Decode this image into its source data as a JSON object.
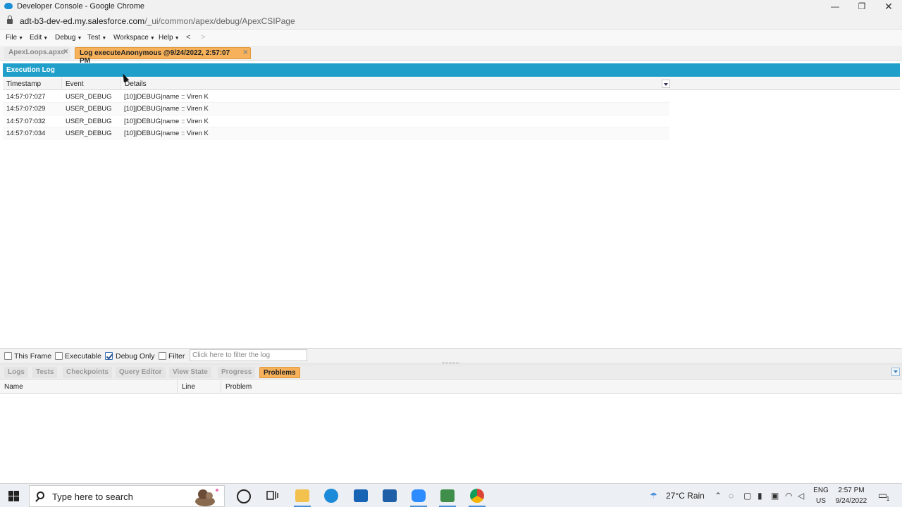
{
  "window": {
    "title": "Developer Console - Google Chrome",
    "minimize": "—",
    "maximize": "❐",
    "close": "✕"
  },
  "address": {
    "host": "adt-b3-dev-ed.my.salesforce.com",
    "path": "/_ui/common/apex/debug/ApexCSIPage"
  },
  "menu": {
    "items": [
      "File",
      "Edit",
      "Debug",
      "Test",
      "Workspace",
      "Help"
    ],
    "back": "<",
    "forward": ">"
  },
  "editor_tabs": [
    {
      "label": "ApexLoops.apxc",
      "active": false
    },
    {
      "label": "Log executeAnonymous @9/24/2022, 2:57:07 PM",
      "active": true
    }
  ],
  "execution_log": {
    "title": "Execution Log",
    "columns": [
      "Timestamp",
      "Event",
      "Details"
    ],
    "rows": [
      {
        "timestamp": "14:57:07:027",
        "event": "USER_DEBUG",
        "details": "[10]|DEBUG|name :: Viren K"
      },
      {
        "timestamp": "14:57:07:029",
        "event": "USER_DEBUG",
        "details": "[10]|DEBUG|name :: Viren K"
      },
      {
        "timestamp": "14:57:07:032",
        "event": "USER_DEBUG",
        "details": "[10]|DEBUG|name :: Viren K"
      },
      {
        "timestamp": "14:57:07:034",
        "event": "USER_DEBUG",
        "details": "[10]|DEBUG|name :: Viren K"
      }
    ]
  },
  "filters": {
    "this_frame": {
      "label": "This Frame",
      "checked": false
    },
    "executable": {
      "label": "Executable",
      "checked": false
    },
    "debug_only": {
      "label": "Debug Only",
      "checked": true
    },
    "filter": {
      "label": "Filter",
      "checked": false
    },
    "filter_placeholder": "Click here to filter the log"
  },
  "bottom_tabs": [
    {
      "label": "Logs",
      "active": false
    },
    {
      "label": "Tests",
      "active": false
    },
    {
      "label": "Checkpoints",
      "active": false
    },
    {
      "label": "Query Editor",
      "active": false
    },
    {
      "label": "View State",
      "active": false
    },
    {
      "label": "Progress",
      "active": false
    },
    {
      "label": "Problems",
      "active": true
    }
  ],
  "problems": {
    "columns": [
      "Name",
      "Line",
      "Problem"
    ]
  },
  "taskbar": {
    "search_placeholder": "Type here to search",
    "weather": "27°C  Rain",
    "language": "ENG",
    "region": "US",
    "time": "2:57 PM",
    "date": "9/24/2022",
    "notification_count": "1"
  },
  "colors": {
    "panel_header": "#1f9fc9",
    "active_tab": "#f6b15a"
  }
}
